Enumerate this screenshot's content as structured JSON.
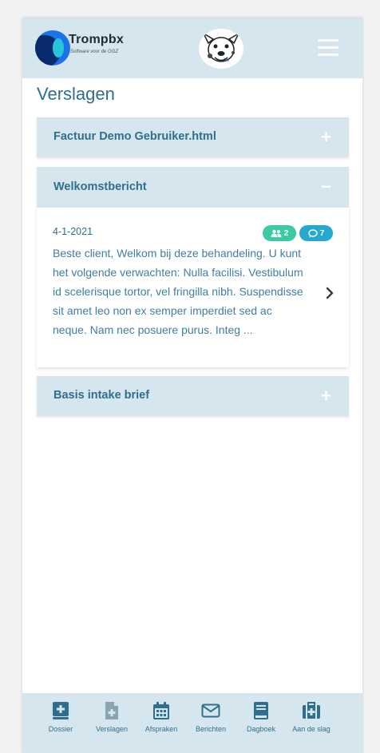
{
  "header": {
    "brand_name": "Trompbx",
    "brand_tagline": "Software voor de GGZ",
    "mascot_icon": "mascot-dog-icon",
    "menu_icon": "hamburger-menu-icon"
  },
  "page": {
    "title": "Verslagen"
  },
  "accordion": [
    {
      "title": "Factuur Demo Gebruiker.html",
      "sign": "+",
      "expanded": false
    },
    {
      "title": "Welkomstbericht",
      "sign": "−",
      "expanded": true
    },
    {
      "title": "Basis intake brief",
      "sign": "+",
      "expanded": false
    }
  ],
  "report": {
    "date": "4-1-2021",
    "participants_count": "2",
    "comments_count": "7",
    "excerpt": "Beste client,   Welkom bij deze behandeling. U kunt het volgende verwachten:   Nulla facilisi. Vestibulum id scelerisque tortor, vel fringilla nibh. Suspendisse sit amet leo non ex semper imperdiet sed ac neque. Nam nec posuere purus. Integ ..."
  },
  "bottom_nav": [
    {
      "label": "Dossier",
      "icon": "dossier-icon"
    },
    {
      "label": "Verslagen",
      "icon": "verslagen-icon",
      "active": true
    },
    {
      "label": "Afspraken",
      "icon": "calendar-icon"
    },
    {
      "label": "Berichten",
      "icon": "envelope-icon"
    },
    {
      "label": "Dagboek",
      "icon": "book-icon"
    },
    {
      "label": "Aan de slag",
      "icon": "first-aid-kit-icon"
    }
  ],
  "colors": {
    "primary": "#2f6f8d",
    "panel": "#d6e6ee",
    "badge_green": "#3cc9a6",
    "badge_blue": "#26a9d1"
  }
}
